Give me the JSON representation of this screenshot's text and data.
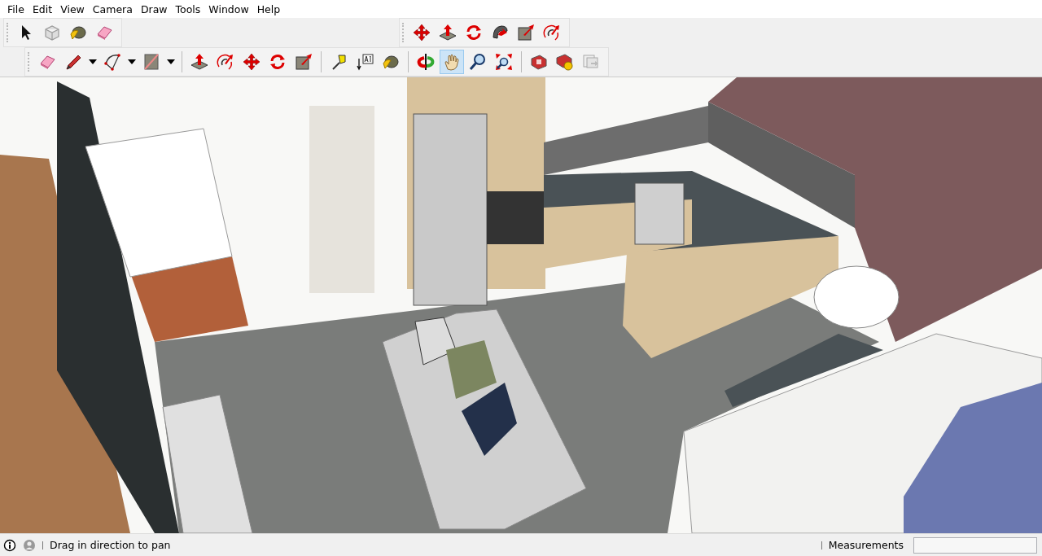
{
  "menu_bar": {
    "items": [
      "File",
      "Edit",
      "View",
      "Camera",
      "Draw",
      "Tools",
      "Window",
      "Help"
    ]
  },
  "top_toolbars": [
    {
      "tools": [
        {
          "kind": "select",
          "selected": false
        },
        {
          "kind": "component",
          "selected": false
        },
        {
          "kind": "paint",
          "selected": false
        },
        {
          "kind": "eraser",
          "selected": false
        }
      ]
    },
    {
      "tools": [
        {
          "kind": "move",
          "selected": false
        },
        {
          "kind": "pushpull",
          "selected": false
        },
        {
          "kind": "rotate",
          "selected": false
        },
        {
          "kind": "followme",
          "selected": false
        },
        {
          "kind": "scale",
          "selected": false
        },
        {
          "kind": "offset",
          "selected": false
        }
      ]
    }
  ],
  "main_toolbar": {
    "tools": [
      {
        "kind": "eraser",
        "selected": false
      },
      {
        "kind": "pencil",
        "selected": false,
        "dropdown": true
      },
      {
        "kind": "arc",
        "selected": false,
        "dropdown": true
      },
      {
        "kind": "rectangle",
        "selected": false,
        "dropdown": true
      },
      {
        "kind": "separator"
      },
      {
        "kind": "pushpull",
        "selected": false
      },
      {
        "kind": "offset",
        "selected": false
      },
      {
        "kind": "move",
        "selected": false
      },
      {
        "kind": "rotate",
        "selected": false
      },
      {
        "kind": "scale",
        "selected": false
      },
      {
        "kind": "separator"
      },
      {
        "kind": "tape",
        "selected": false
      },
      {
        "kind": "text",
        "selected": false
      },
      {
        "kind": "paint",
        "selected": false
      },
      {
        "kind": "separator"
      },
      {
        "kind": "orbit",
        "selected": false
      },
      {
        "kind": "pan",
        "selected": true
      },
      {
        "kind": "zoom",
        "selected": false
      },
      {
        "kind": "zoomext",
        "selected": false
      },
      {
        "kind": "separator"
      },
      {
        "kind": "warehouse",
        "selected": false
      },
      {
        "kind": "extension",
        "selected": false
      },
      {
        "kind": "layout",
        "selected": false
      }
    ]
  },
  "status_bar": {
    "hint": "Drag in direction to pan",
    "measurements_label": "Measurements"
  }
}
